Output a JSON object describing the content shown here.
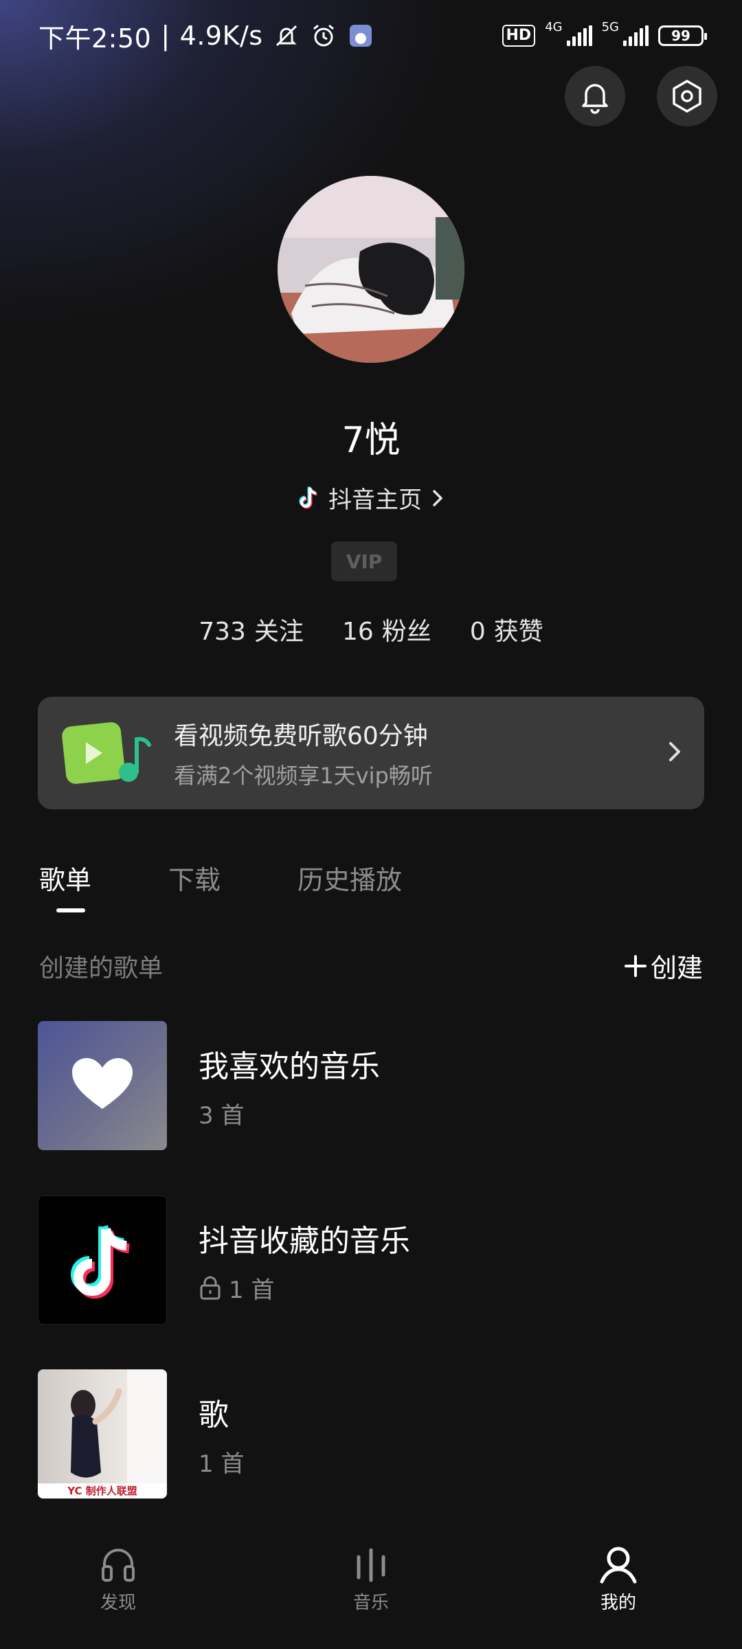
{
  "status_bar": {
    "time": "下午2:50",
    "speed": "4.9K/s",
    "hd": "HD",
    "net1": "4G",
    "net2": "5G",
    "battery": "99"
  },
  "profile": {
    "username": "7悦",
    "douyin_link": "抖音主页",
    "vip": "VIP",
    "stats": [
      {
        "value": "733",
        "label": "关注"
      },
      {
        "value": "16",
        "label": "粉丝"
      },
      {
        "value": "0",
        "label": "获赞"
      }
    ]
  },
  "promo": {
    "title": "看视频免费听歌60分钟",
    "subtitle": "看满2个视频享1天vip畅听"
  },
  "tabs": [
    {
      "label": "歌单",
      "active": true
    },
    {
      "label": "下载",
      "active": false
    },
    {
      "label": "历史播放",
      "active": false
    }
  ],
  "section": {
    "title": "创建的歌单",
    "create_label": "创建"
  },
  "playlists": [
    {
      "name": "我喜欢的音乐",
      "count": "3 首",
      "locked": false
    },
    {
      "name": "抖音收藏的音乐",
      "count": "1 首",
      "locked": true
    },
    {
      "name": "歌",
      "count": "1 首",
      "locked": false,
      "cover_caption": "YC 制作人联盟"
    }
  ],
  "bottom_nav": [
    {
      "label": "发现",
      "icon": "headphones-icon"
    },
    {
      "label": "音乐",
      "icon": "music-bars-icon"
    },
    {
      "label": "我的",
      "icon": "person-icon",
      "active": true
    }
  ],
  "colors": {
    "background": "#121212",
    "card": "#3a3a3a",
    "muted_text": "#8c8c8c"
  }
}
